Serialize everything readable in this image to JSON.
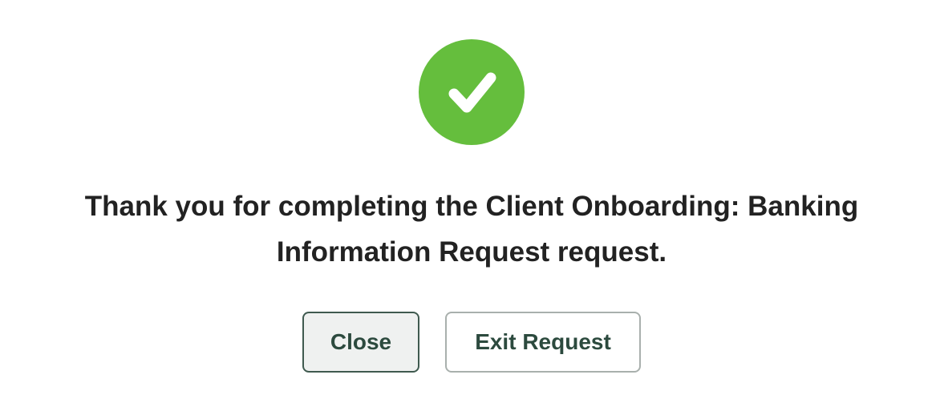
{
  "colors": {
    "success_green": "#65be3d",
    "check_white": "#ffffff",
    "text_dark": "#222222",
    "button_text": "#2c4a3e"
  },
  "icon": {
    "name": "check-icon"
  },
  "message": {
    "text": "Thank you for completing the Client Onboarding: Banking Information Request request."
  },
  "buttons": {
    "close_label": "Close",
    "exit_label": "Exit Request"
  }
}
